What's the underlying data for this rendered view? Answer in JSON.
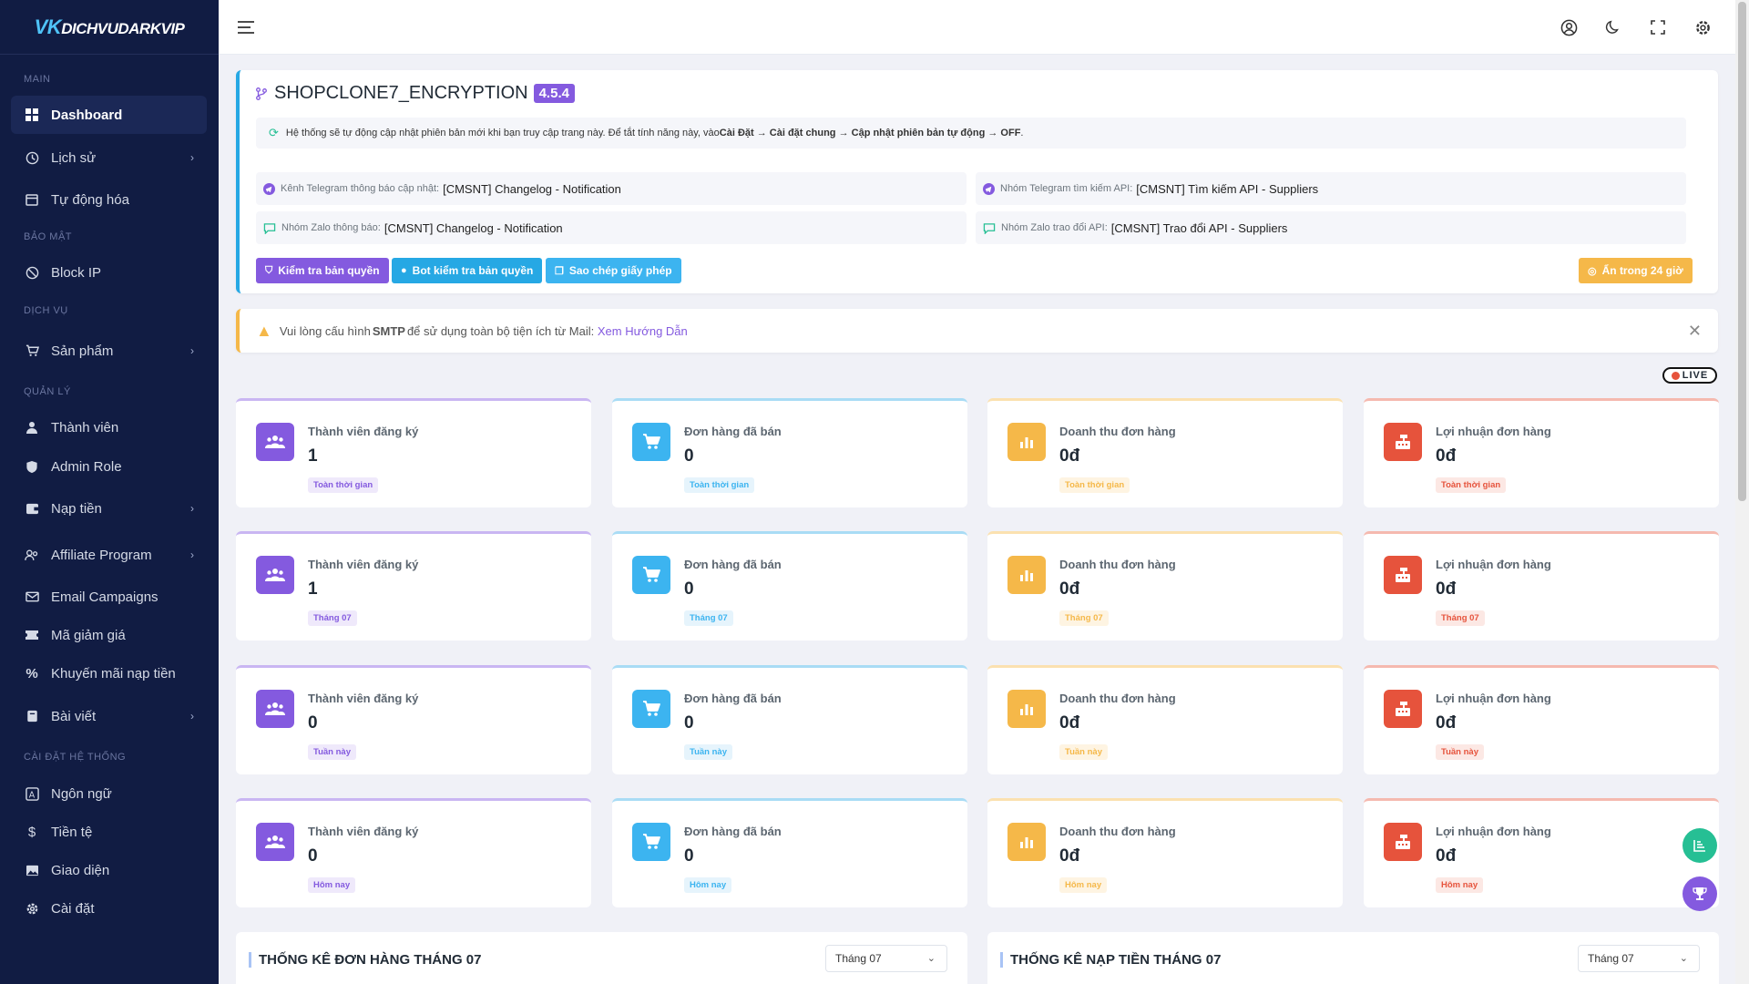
{
  "brand": {
    "logo_vk": "VK",
    "logo_text": "DICHVUDARKVIP"
  },
  "sidebar": {
    "sections": {
      "main": "MAIN",
      "security": "BẢO MẬT",
      "service": "DỊCH VỤ",
      "manage": "QUẢN LÝ",
      "settings": "CÀI ĐẶT HỆ THỐNG"
    },
    "items": {
      "dashboard": "Dashboard",
      "history": "Lịch sử",
      "automation": "Tự động hóa",
      "block_ip": "Block IP",
      "products": "Sản phẩm",
      "members": "Thành viên",
      "admin_role": "Admin Role",
      "deposit": "Nạp tiền",
      "affiliate": "Affiliate Program",
      "email": "Email Campaigns",
      "coupon": "Mã giảm giá",
      "promo": "Khuyến mãi nạp tiền",
      "posts": "Bài viết",
      "language": "Ngôn ngữ",
      "currency": "Tiền tệ",
      "theme": "Giao diện",
      "settings": "Cài đặt"
    }
  },
  "version": {
    "name": "SHOPCLONE7_ENCRYPTION",
    "number": "4.5.4",
    "info_prefix": "Hệ thống sẽ tự động cập nhật phiên bản mới khi bạn truy cập trang này. Để tắt tính năng này, vào ",
    "info_path": "Cài Đặt → Cài đặt chung → Cập nhật phiên bản tự động → OFF",
    "info_suffix": ".",
    "links": {
      "tg_channel_label": "Kênh Telegram thông báo cập nhật:",
      "tg_channel_value": "[CMSNT] Changelog - Notification",
      "tg_group_label": "Nhóm Telegram tìm kiếm API:",
      "tg_group_value": "[CMSNT] Tìm kiếm API - Suppliers",
      "zalo_notify_label": "Nhóm Zalo thông báo:",
      "zalo_notify_value": "[CMSNT] Changelog - Notification",
      "zalo_api_label": "Nhóm Zalo trao đổi API:",
      "zalo_api_value": "[CMSNT] Trao đổi API - Suppliers"
    },
    "buttons": {
      "check_license": "Kiểm tra bản quyền",
      "bot_check": "Bot kiểm tra bản quyền",
      "copy_license": "Sao chép giấy phép",
      "hide_24h": "Ẩn trong 24 giờ"
    }
  },
  "alert": {
    "prefix": "Vui lòng cấu hình ",
    "bold": "SMTP",
    "middle": " để sử dụng toàn bộ tiện ích từ Mail: ",
    "link": "Xem Hướng Dẫn",
    "close": "✕"
  },
  "live_label": "LIVE",
  "stats_labels": {
    "members": "Thành viên đăng ký",
    "orders": "Đơn hàng đã bán",
    "revenue": "Doanh thu đơn hàng",
    "profit": "Lợi nhuận đơn hàng"
  },
  "stats_rows": [
    {
      "period": "Toàn thời gian",
      "members": "1",
      "orders": "0",
      "revenue": "0đ",
      "profit": "0đ"
    },
    {
      "period": "Tháng 07",
      "members": "1",
      "orders": "0",
      "revenue": "0đ",
      "profit": "0đ"
    },
    {
      "period": "Tuần này",
      "members": "0",
      "orders": "0",
      "revenue": "0đ",
      "profit": "0đ"
    },
    {
      "period": "Hôm nay",
      "members": "0",
      "orders": "0",
      "revenue": "0đ",
      "profit": "0đ"
    }
  ],
  "colors": {
    "purple": "#845adf",
    "blue": "#3cb4f0",
    "yellow": "#f5b849",
    "red": "#e6533c"
  },
  "bottom": {
    "orders_title": "THỐNG KÊ ĐƠN HÀNG THÁNG 07",
    "orders_select": "Tháng 07",
    "deposit_title": "THỐNG KÊ NẠP TIỀN THÁNG 07",
    "deposit_select": "Tháng 07"
  }
}
